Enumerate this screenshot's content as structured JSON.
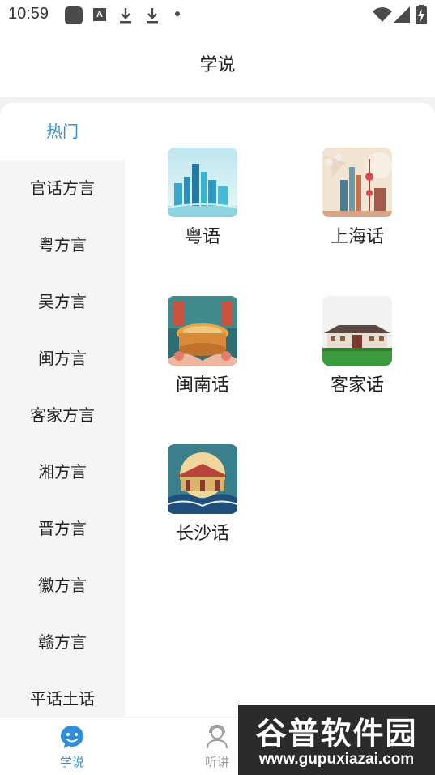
{
  "status_bar": {
    "time": "10:59",
    "a_icon_label": "A",
    "icons": [
      "app-icon",
      "a-icon",
      "download-icon",
      "download-icon",
      "notification-dot",
      "wifi-icon",
      "signal-icon",
      "battery-charging-icon"
    ]
  },
  "header": {
    "title": "学说"
  },
  "sidebar": {
    "active_index": 0,
    "items": [
      {
        "label": "热门"
      },
      {
        "label": "官话方言"
      },
      {
        "label": "粤方言"
      },
      {
        "label": "吴方言"
      },
      {
        "label": "闽方言"
      },
      {
        "label": "客家方言"
      },
      {
        "label": "湘方言"
      },
      {
        "label": "晋方言"
      },
      {
        "label": "徽方言"
      },
      {
        "label": "赣方言"
      },
      {
        "label": "平话土话"
      }
    ]
  },
  "dialects": [
    {
      "label": "粤语",
      "icon": "city-skyline-thumbnail"
    },
    {
      "label": "上海话",
      "icon": "shanghai-skyline-thumbnail"
    },
    {
      "label": "闽南话",
      "icon": "tulou-thumbnail"
    },
    {
      "label": "客家话",
      "icon": "hakka-roundhouse-thumbnail"
    },
    {
      "label": "长沙话",
      "icon": "pavilion-moon-thumbnail"
    }
  ],
  "bottom_nav": {
    "tabs": [
      {
        "label": "学说",
        "icon": "chat-bubble-smile-icon",
        "active": true
      },
      {
        "label": "听讲",
        "icon": "headset-person-icon",
        "active": false
      }
    ]
  },
  "watermark": {
    "top_text": "谷普软件园",
    "bottom_text": "www.gupuxiazai.com"
  },
  "colors": {
    "accent": "#2f8fdd",
    "sidebar_bg": "#f5f5f5",
    "page_bg": "#f2f2f2"
  }
}
